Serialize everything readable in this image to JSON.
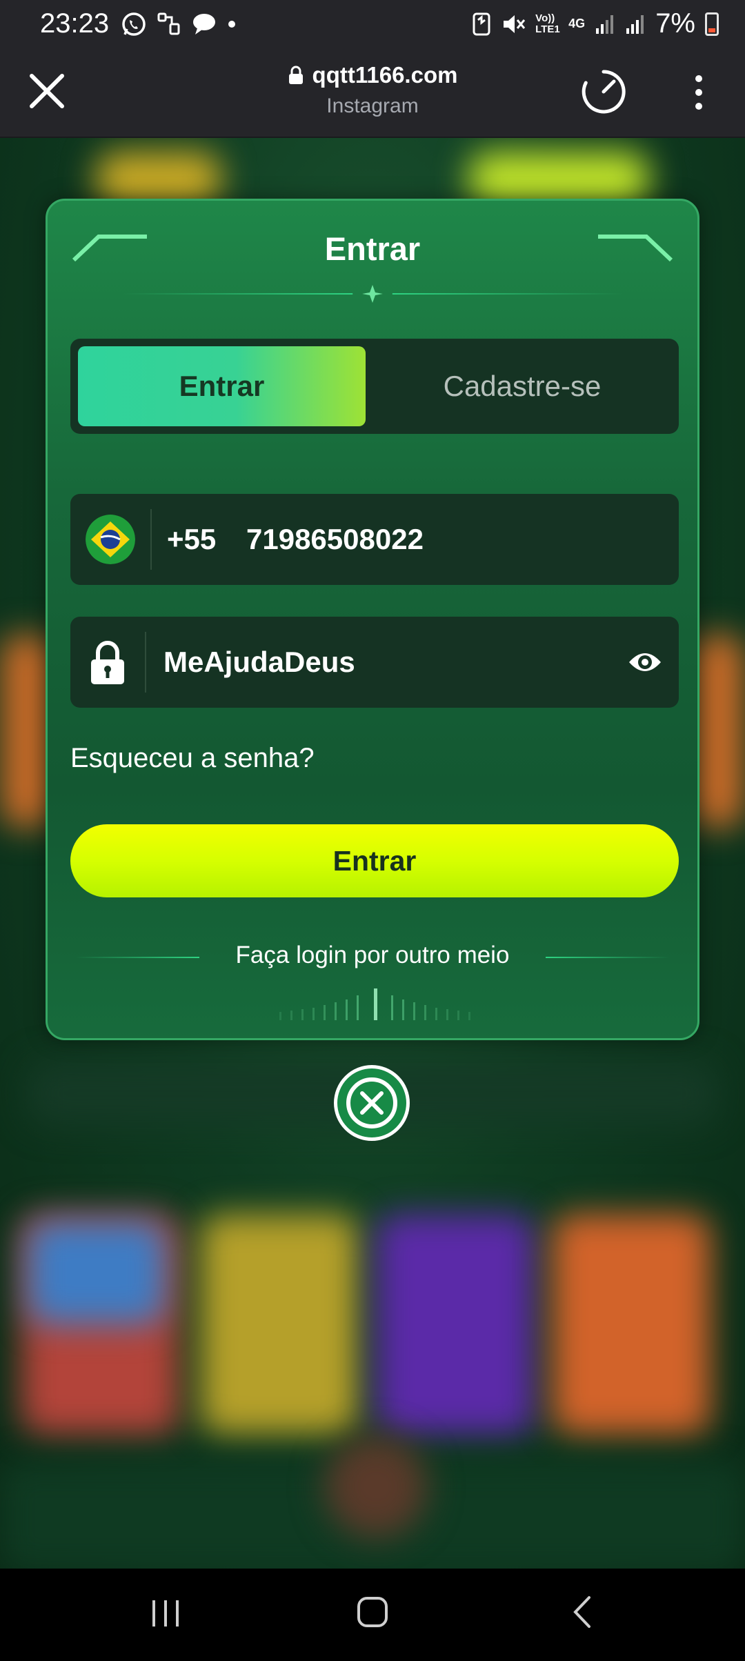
{
  "status_bar": {
    "time": "23:23",
    "battery_percent": "7%",
    "network_label_1": "Vo)) LTE1",
    "network_label_2": "4G",
    "left_icons": [
      "whatsapp-icon",
      "link-icon",
      "chat-icon",
      "dot-icon"
    ],
    "right_icons": [
      "nfc-icon",
      "mute-icon",
      "signal-icon",
      "signal-icon",
      "battery-icon"
    ]
  },
  "browser": {
    "url": "qqtt1166.com",
    "subtitle": "Instagram",
    "icons": [
      "close-icon",
      "lock-icon",
      "speed-icon",
      "more-vert-icon"
    ]
  },
  "modal": {
    "title": "Entrar",
    "tabs": [
      {
        "label": "Entrar",
        "active": true
      },
      {
        "label": "Cadastre-se",
        "active": false
      }
    ],
    "phone": {
      "country_code": "+55",
      "value": "71986508022",
      "flag": "brazil-flag-icon"
    },
    "password": {
      "value": "MeAjudaDeus",
      "icon": "lock-icon",
      "toggle_icon": "eye-icon"
    },
    "forgot_label": "Esqueceu a senha?",
    "submit_label": "Entrar",
    "other_login_label": "Faça login por outro meio"
  },
  "colors": {
    "modal_bg": "#17683a",
    "tab_active": "#38d294",
    "button_bg": "#d6ff00",
    "field_bg": "#153323",
    "close_circle": "#178a46"
  },
  "nav": {
    "icons": [
      "recent-apps-icon",
      "home-icon",
      "back-icon"
    ]
  }
}
